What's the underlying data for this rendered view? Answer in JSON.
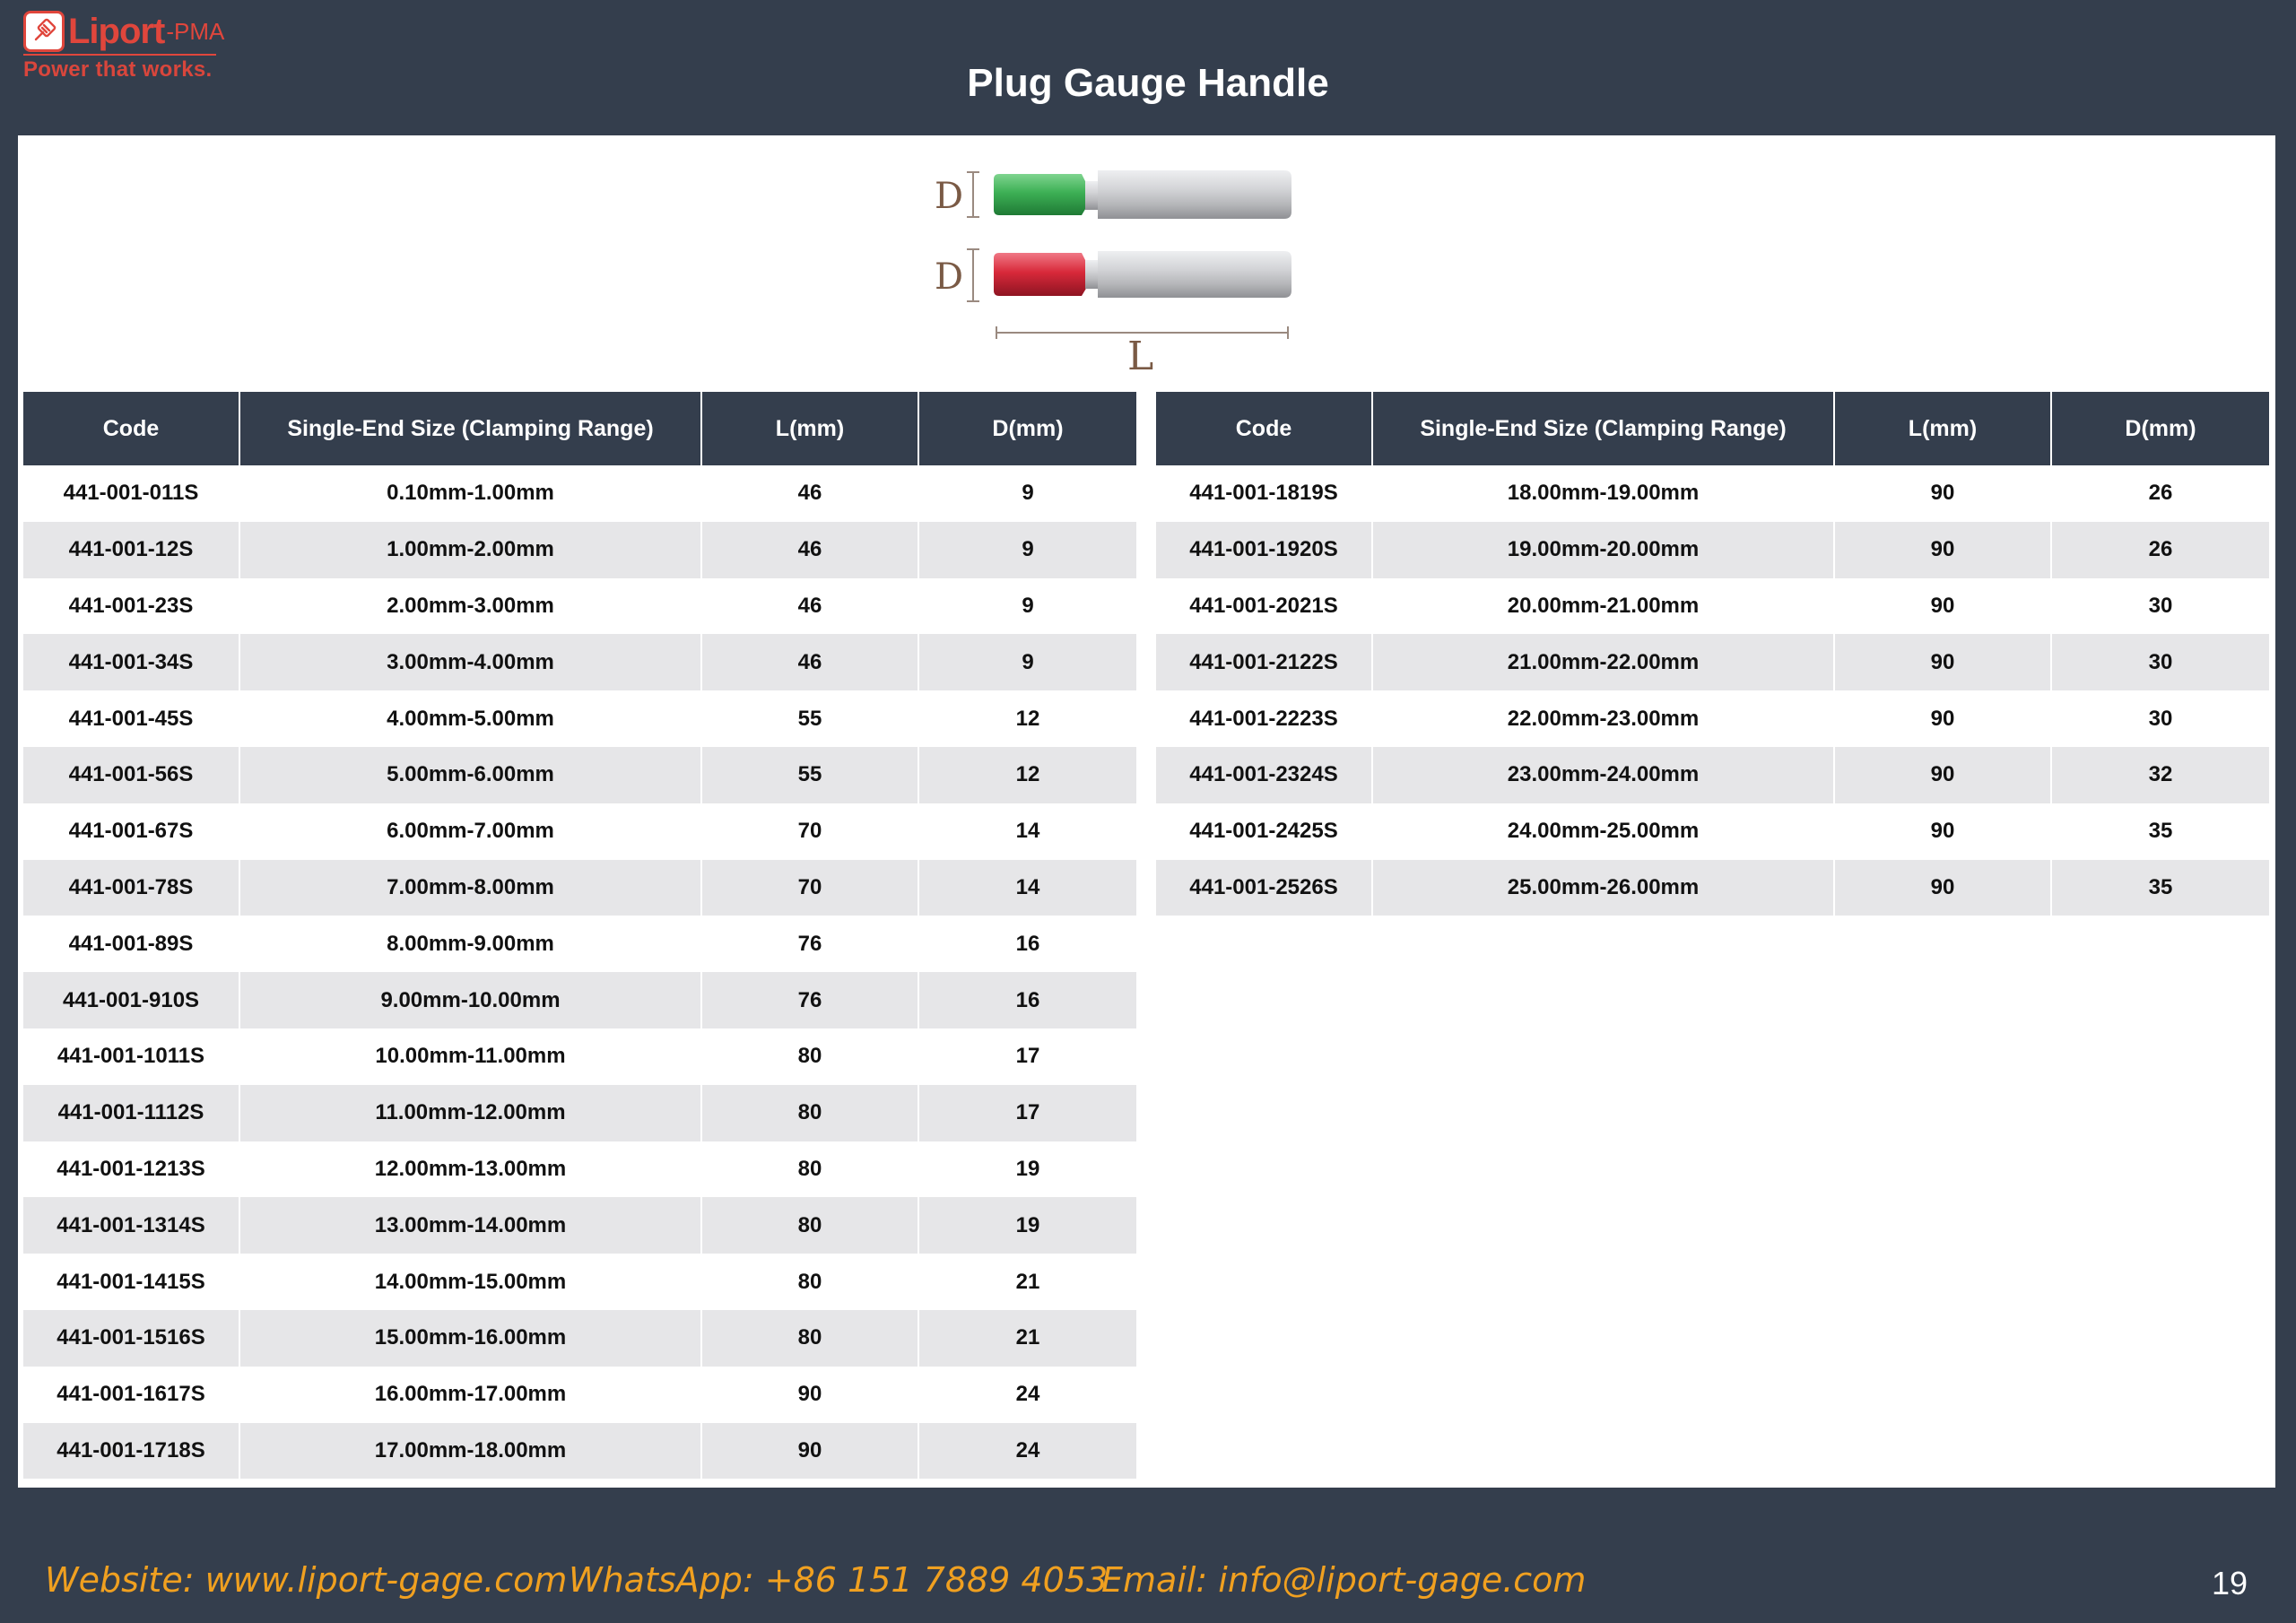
{
  "logo": {
    "name": "Liport",
    "suffix": "-PMA",
    "tagline": "Power that works."
  },
  "title": "Plug Gauge Handle",
  "diagram": {
    "d_label_top": "D",
    "d_label_bottom": "D",
    "l_label": "L",
    "colors": {
      "green": "#3db055",
      "red": "#d8293a",
      "silver": "#cfd0d3"
    }
  },
  "headers": [
    "Code",
    "Single-End Size (Clamping Range)",
    "L(mm)",
    "D(mm)"
  ],
  "left_rows": [
    [
      "441-001-011S",
      "0.10mm-1.00mm",
      "46",
      "9"
    ],
    [
      "441-001-12S",
      "1.00mm-2.00mm",
      "46",
      "9"
    ],
    [
      "441-001-23S",
      "2.00mm-3.00mm",
      "46",
      "9"
    ],
    [
      "441-001-34S",
      "3.00mm-4.00mm",
      "46",
      "9"
    ],
    [
      "441-001-45S",
      "4.00mm-5.00mm",
      "55",
      "12"
    ],
    [
      "441-001-56S",
      "5.00mm-6.00mm",
      "55",
      "12"
    ],
    [
      "441-001-67S",
      "6.00mm-7.00mm",
      "70",
      "14"
    ],
    [
      "441-001-78S",
      "7.00mm-8.00mm",
      "70",
      "14"
    ],
    [
      "441-001-89S",
      "8.00mm-9.00mm",
      "76",
      "16"
    ],
    [
      "441-001-910S",
      "9.00mm-10.00mm",
      "76",
      "16"
    ],
    [
      "441-001-1011S",
      "10.00mm-11.00mm",
      "80",
      "17"
    ],
    [
      "441-001-1112S",
      "11.00mm-12.00mm",
      "80",
      "17"
    ],
    [
      "441-001-1213S",
      "12.00mm-13.00mm",
      "80",
      "19"
    ],
    [
      "441-001-1314S",
      "13.00mm-14.00mm",
      "80",
      "19"
    ],
    [
      "441-001-1415S",
      "14.00mm-15.00mm",
      "80",
      "21"
    ],
    [
      "441-001-1516S",
      "15.00mm-16.00mm",
      "80",
      "21"
    ],
    [
      "441-001-1617S",
      "16.00mm-17.00mm",
      "90",
      "24"
    ],
    [
      "441-001-1718S",
      "17.00mm-18.00mm",
      "90",
      "24"
    ]
  ],
  "right_rows": [
    [
      "441-001-1819S",
      "18.00mm-19.00mm",
      "90",
      "26"
    ],
    [
      "441-001-1920S",
      "19.00mm-20.00mm",
      "90",
      "26"
    ],
    [
      "441-001-2021S",
      "20.00mm-21.00mm",
      "90",
      "30"
    ],
    [
      "441-001-2122S",
      "21.00mm-22.00mm",
      "90",
      "30"
    ],
    [
      "441-001-2223S",
      "22.00mm-23.00mm",
      "90",
      "30"
    ],
    [
      "441-001-2324S",
      "23.00mm-24.00mm",
      "90",
      "32"
    ],
    [
      "441-001-2425S",
      "24.00mm-25.00mm",
      "90",
      "35"
    ],
    [
      "441-001-2526S",
      "25.00mm-26.00mm",
      "90",
      "35"
    ]
  ],
  "footer": {
    "website": "Website: www.liport-gage.com",
    "whatsapp": "WhatsApp: +86 151 7889 4053",
    "email": "Email: info@liport-gage.com",
    "page_number": "19"
  }
}
